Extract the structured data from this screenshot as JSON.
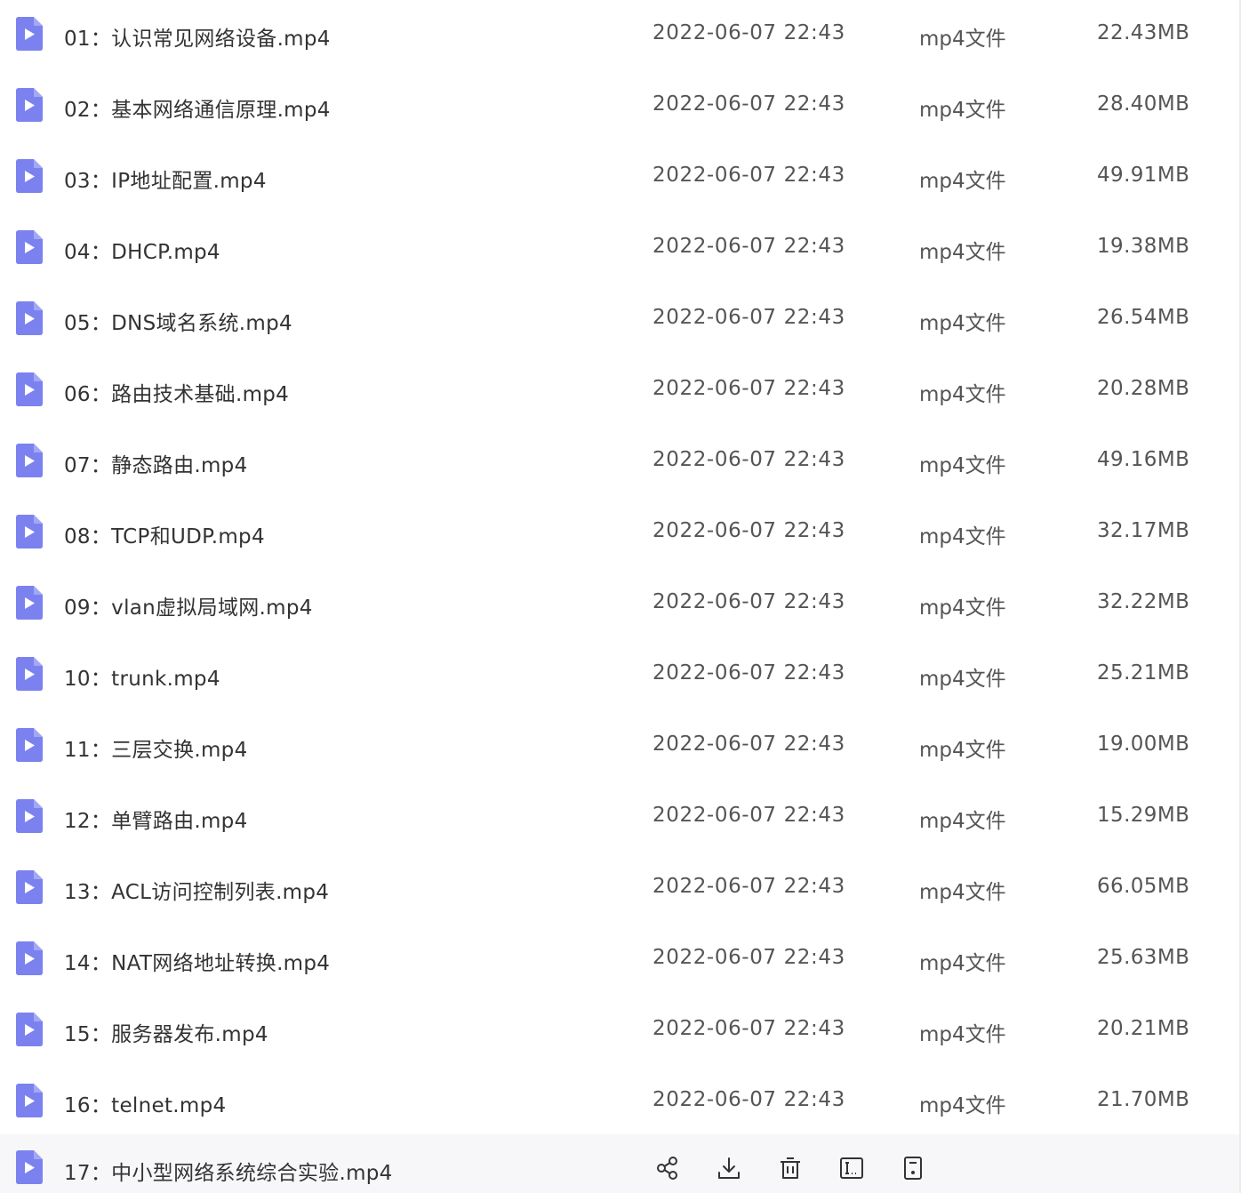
{
  "files": [
    {
      "name": "01：认识常见网络设备.mp4",
      "date": "2022-06-07 22:43",
      "type": "mp4文件",
      "size": "22.43MB"
    },
    {
      "name": "02：基本网络通信原理.mp4",
      "date": "2022-06-07 22:43",
      "type": "mp4文件",
      "size": "28.40MB"
    },
    {
      "name": "03：IP地址配置.mp4",
      "date": "2022-06-07 22:43",
      "type": "mp4文件",
      "size": "49.91MB"
    },
    {
      "name": "04：DHCP.mp4",
      "date": "2022-06-07 22:43",
      "type": "mp4文件",
      "size": "19.38MB"
    },
    {
      "name": "05：DNS域名系统.mp4",
      "date": "2022-06-07 22:43",
      "type": "mp4文件",
      "size": "26.54MB"
    },
    {
      "name": "06：路由技术基础.mp4",
      "date": "2022-06-07 22:43",
      "type": "mp4文件",
      "size": "20.28MB"
    },
    {
      "name": "07：静态路由.mp4",
      "date": "2022-06-07 22:43",
      "type": "mp4文件",
      "size": "49.16MB"
    },
    {
      "name": "08：TCP和UDP.mp4",
      "date": "2022-06-07 22:43",
      "type": "mp4文件",
      "size": "32.17MB"
    },
    {
      "name": "09：vlan虚拟局域网.mp4",
      "date": "2022-06-07 22:43",
      "type": "mp4文件",
      "size": "32.22MB"
    },
    {
      "name": "10：trunk.mp4",
      "date": "2022-06-07 22:43",
      "type": "mp4文件",
      "size": "25.21MB"
    },
    {
      "name": "11：三层交换.mp4",
      "date": "2022-06-07 22:43",
      "type": "mp4文件",
      "size": "19.00MB"
    },
    {
      "name": "12：单臂路由.mp4",
      "date": "2022-06-07 22:43",
      "type": "mp4文件",
      "size": "15.29MB"
    },
    {
      "name": "13：ACL访问控制列表.mp4",
      "date": "2022-06-07 22:43",
      "type": "mp4文件",
      "size": "66.05MB"
    },
    {
      "name": "14：NAT网络地址转换.mp4",
      "date": "2022-06-07 22:43",
      "type": "mp4文件",
      "size": "25.63MB"
    },
    {
      "name": "15：服务器发布.mp4",
      "date": "2022-06-07 22:43",
      "type": "mp4文件",
      "size": "20.21MB"
    },
    {
      "name": "16：telnet.mp4",
      "date": "2022-06-07 22:43",
      "type": "mp4文件",
      "size": "21.70MB"
    },
    {
      "name": "17：中小型网络系统综合实验.mp4",
      "hovered": true
    }
  ],
  "hover_actions": [
    "share-icon",
    "download-icon",
    "delete-icon",
    "rename-icon",
    "more-icon"
  ],
  "colors": {
    "file_icon": "#7b82ef",
    "file_icon_light": "#a3a8f5",
    "action_icon": "#333333",
    "hover_row_bg": "#f7f7fa"
  }
}
